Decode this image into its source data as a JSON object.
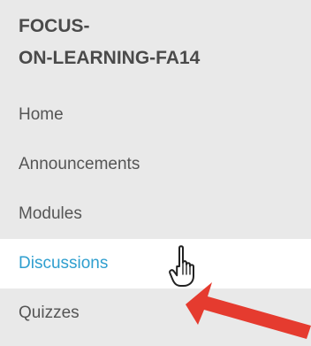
{
  "course": {
    "title_line_1": "FOCUS-",
    "title_line_2": "ON-LEARNING-FA14"
  },
  "nav": {
    "items": [
      {
        "label": "Home",
        "active": false
      },
      {
        "label": "Announcements",
        "active": false
      },
      {
        "label": "Modules",
        "active": false
      },
      {
        "label": "Discussions",
        "active": true
      },
      {
        "label": "Quizzes",
        "active": false
      }
    ]
  },
  "cursor": {
    "icon": "hand-pointer-icon"
  },
  "annotation": {
    "icon": "red-arrow-icon",
    "color": "#e53b2f"
  },
  "colors": {
    "sidebar_background": "#e9e9e9",
    "active_background": "#ffffff",
    "active_text": "#2f9fcf",
    "default_text": "#555555",
    "title_text": "#4a4a4a"
  }
}
